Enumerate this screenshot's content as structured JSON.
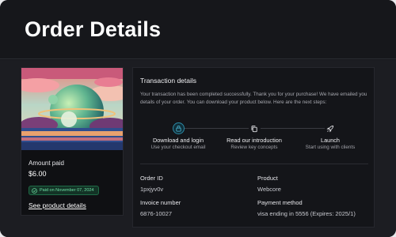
{
  "page": {
    "title": "Order Details"
  },
  "product_card": {
    "amount_label": "Amount paid",
    "amount_value": "$6.00",
    "paid_badge": "Paid on November 07, 2024",
    "product_link": "See product details"
  },
  "transaction": {
    "title": "Transaction details",
    "message": "Your transaction has been completed successfully. Thank you for your purchase! We have emailed you details of your order. You can download your product below. Here are the next steps:",
    "steps": [
      {
        "title": "Download and login",
        "subtitle": "Use your checkout email",
        "icon": "lock-icon",
        "active": true
      },
      {
        "title": "Read our introduction",
        "subtitle": "Review key concepts",
        "icon": "copy-icon",
        "active": false
      },
      {
        "title": "Launch",
        "subtitle": "Start using with clients",
        "icon": "rocket-icon",
        "active": false
      }
    ],
    "fields": {
      "order_id_label": "Order ID",
      "order_id_value": "1pxjyv0v",
      "product_label": "Product",
      "product_value": "Webcore",
      "invoice_label": "Invoice number",
      "invoice_value": "6876-10027",
      "payment_label": "Payment method",
      "payment_value": "visa ending in 5556 (Expires: 2025/1)"
    }
  },
  "colors": {
    "background": "#17181c",
    "accent": "#2c8aa6",
    "success": "#6fe0a5"
  }
}
